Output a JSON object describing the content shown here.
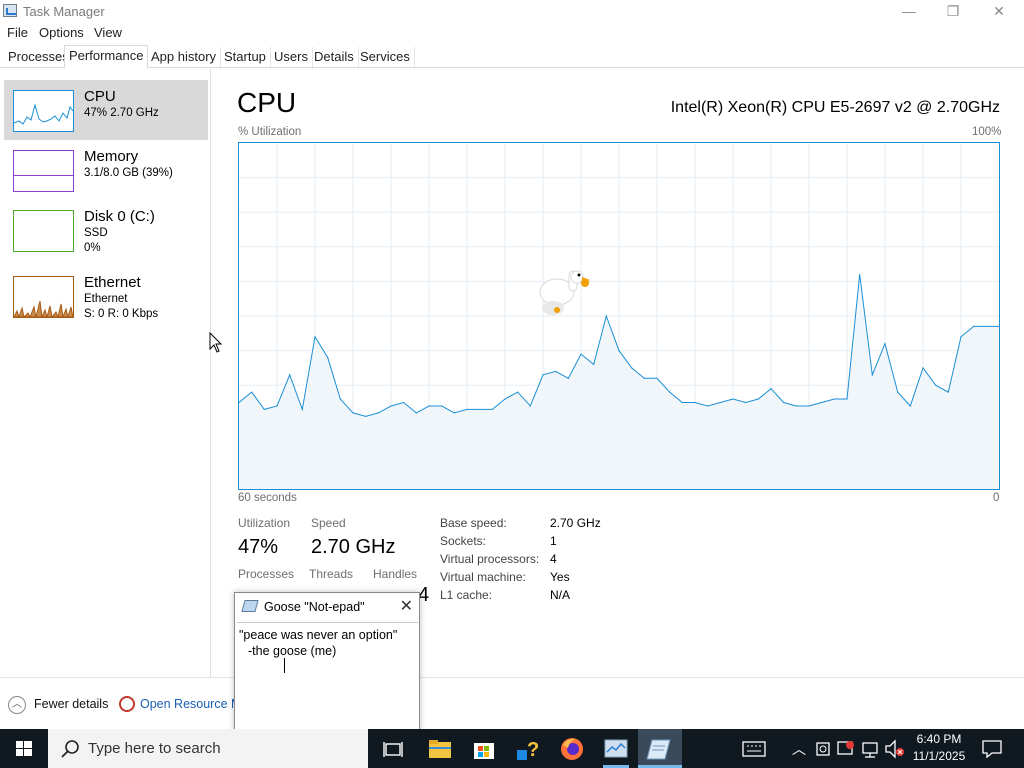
{
  "window": {
    "title": "Task Manager",
    "minimize": "—",
    "restore": "❐",
    "close": "✕"
  },
  "menu": [
    "File",
    "Options",
    "View"
  ],
  "tabs": [
    "Processes",
    "Performance",
    "App history",
    "Startup",
    "Users",
    "Details",
    "Services"
  ],
  "active_tab": "Performance",
  "sidebar": {
    "items": [
      {
        "title": "CPU",
        "sub1": "47% 2.70 GHz",
        "sub2": "",
        "color": "#1a8fd4"
      },
      {
        "title": "Memory",
        "sub1": "3.1/8.0 GB (39%)",
        "sub2": "",
        "color": "#8b3fc4"
      },
      {
        "title": "Disk 0 (C:)",
        "sub1": "SSD",
        "sub2": "0%",
        "color": "#4caa2f"
      },
      {
        "title": "Ethernet",
        "sub1": "Ethernet",
        "sub2": "S: 0 R: 0 Kbps",
        "color": "#a75a12"
      }
    ]
  },
  "main": {
    "title": "CPU",
    "model": "Intel(R) Xeon(R) CPU E5-2697 v2 @ 2.70GHz",
    "y_label": "% Utilization",
    "y_max": "100%",
    "x_left": "60 seconds",
    "x_right": "0"
  },
  "stats": {
    "utilization_label": "Utilization",
    "utilization": "47%",
    "speed_label": "Speed",
    "speed": "2.70 GHz",
    "processes_label": "Processes",
    "threads_label": "Threads",
    "handles_label": "Handles",
    "handles_partial": "4"
  },
  "info": [
    {
      "label": "Base speed:",
      "value": "2.70 GHz"
    },
    {
      "label": "Sockets:",
      "value": "1"
    },
    {
      "label": "Virtual processors:",
      "value": "4"
    },
    {
      "label": "Virtual machine:",
      "value": "Yes"
    },
    {
      "label": "L1 cache:",
      "value": "N/A"
    }
  ],
  "bottom": {
    "fewer_details": "Fewer details",
    "resource_monitor": "Open Resource M"
  },
  "notepad": {
    "title": "Goose \"Not-epad\"",
    "close": "✕",
    "line1": "\"peace was never an option\"",
    "line2": "-the goose (me)"
  },
  "taskbar": {
    "search_placeholder": "Type here to search",
    "time": "6:40 PM",
    "date": "11/1/2025"
  },
  "chart_data": {
    "type": "area",
    "title": "CPU",
    "ylabel": "% Utilization",
    "xlabel": "60 seconds",
    "ylim": [
      0,
      100
    ],
    "xlim": [
      60,
      0
    ],
    "grid": true,
    "series": [
      {
        "x": [
          60,
          59,
          58,
          57,
          56,
          55,
          54,
          53,
          52,
          51,
          50,
          49,
          48,
          47,
          46,
          45,
          44,
          43,
          42,
          41,
          40,
          39,
          38,
          37,
          36,
          35,
          34,
          33,
          32,
          31,
          30,
          29,
          28,
          27,
          26,
          25,
          24,
          23,
          22,
          21,
          20,
          19,
          18,
          17,
          16,
          15,
          14,
          13,
          12,
          11,
          10,
          9,
          8,
          7,
          6,
          5,
          4,
          3,
          2,
          1,
          0
        ],
        "values": [
          25,
          28,
          23,
          24,
          33,
          23,
          44,
          38,
          26,
          22,
          21,
          22,
          24,
          25,
          22,
          24,
          24,
          22,
          23,
          23,
          23,
          26,
          28,
          24,
          33,
          34,
          32,
          39,
          36,
          50,
          40,
          35,
          32,
          32,
          28,
          25,
          25,
          24,
          25,
          26,
          25,
          26,
          29,
          25,
          24,
          24,
          25,
          26,
          26,
          62,
          33,
          42,
          28,
          24,
          35,
          30,
          28,
          44,
          47,
          47,
          47
        ]
      }
    ]
  }
}
